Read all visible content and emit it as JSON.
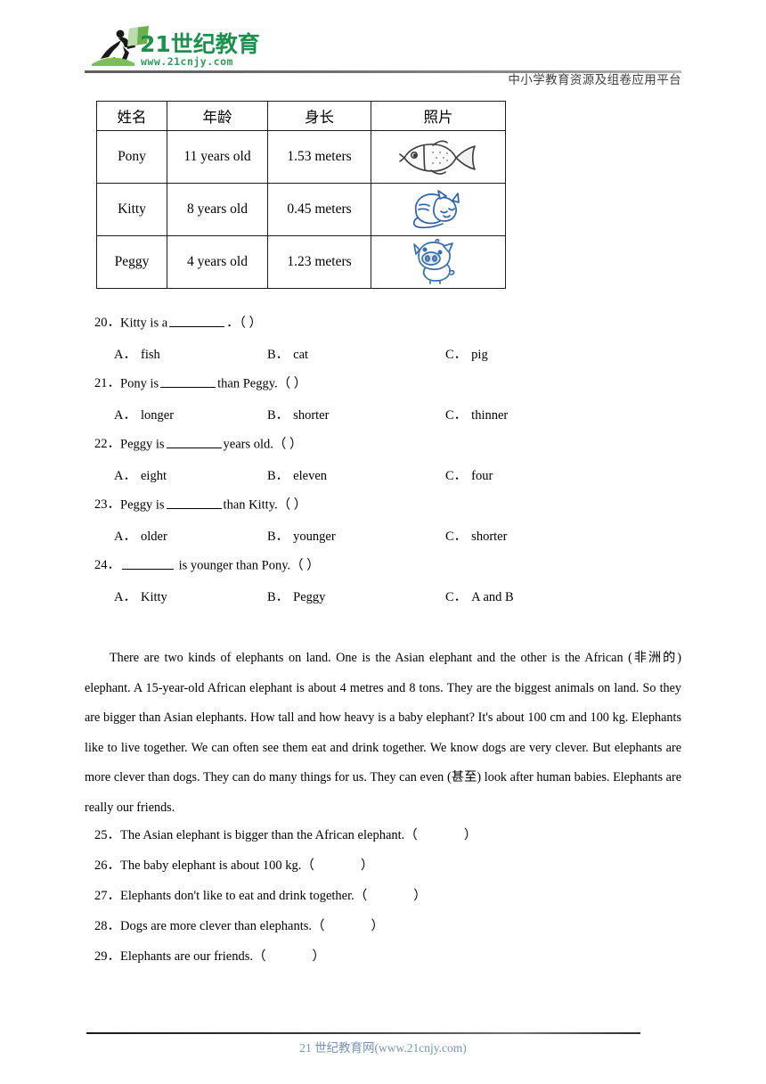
{
  "header": {
    "logo_text_cn": "21世纪教育",
    "logo_text_url": "www.21cnjy.com",
    "slogan": "中小学教育资源及组卷应用平台"
  },
  "table": {
    "headers": [
      "姓名",
      "年龄",
      "身长",
      "照片"
    ],
    "rows": [
      {
        "name": "Pony",
        "age": "11 years old",
        "length": "1.53 meters",
        "photo": "fish-illustration"
      },
      {
        "name": "Kitty",
        "age": "8 years old",
        "length": "0.45 meters",
        "photo": "cat-illustration"
      },
      {
        "name": "Peggy",
        "age": "4 years old",
        "length": "1.23 meters",
        "photo": "pig-illustration"
      }
    ]
  },
  "mcq": [
    {
      "num": "20．",
      "stem_before": "Kitty is a",
      "stem_after": "．（  ）",
      "options": [
        {
          "label": "A．",
          "text": "fish"
        },
        {
          "label": "B．",
          "text": "cat"
        },
        {
          "label": "C．",
          "text": "pig"
        }
      ]
    },
    {
      "num": "21．",
      "stem_before": "Pony is",
      "stem_after": "than Peggy.（  ）",
      "options": [
        {
          "label": "A．",
          "text": "longer"
        },
        {
          "label": "B．",
          "text": "shorter"
        },
        {
          "label": "C．",
          "text": "thinner"
        }
      ]
    },
    {
      "num": "22．",
      "stem_before": "Peggy is",
      "stem_after": "years old.（  ）",
      "options": [
        {
          "label": "A．",
          "text": "eight"
        },
        {
          "label": "B．",
          "text": "eleven"
        },
        {
          "label": "C．",
          "text": "four"
        }
      ]
    },
    {
      "num": "23．",
      "stem_before": "Peggy is",
      "stem_after": "than Kitty.（  ）",
      "options": [
        {
          "label": "A．",
          "text": "older"
        },
        {
          "label": "B．",
          "text": "younger"
        },
        {
          "label": "C．",
          "text": "shorter"
        }
      ]
    },
    {
      "num": "24．",
      "stem_before": "",
      "stem_after": "is younger than Pony.（  ）",
      "options": [
        {
          "label": "A．",
          "text": "Kitty"
        },
        {
          "label": "B．",
          "text": "Peggy"
        },
        {
          "label": "C．",
          "text": "A and B"
        }
      ]
    }
  ],
  "passage": {
    "text": "There are two kinds of elephants on land. One is the Asian elephant and the other is the African (非洲的) elephant. A 15-year-old African elephant is about 4 metres and 8 tons. They are the biggest animals on land. So they are bigger than Asian elephants. How tall and how heavy is a baby elephant? It's about 100 cm and 100 kg. Elephants like to live together. We can often see them eat and drink together. We know dogs are very clever. But elephants are more clever than dogs. They can do many things for us. They can even (甚至) look after human babies. Elephants are really our friends."
  },
  "tf_questions": [
    {
      "num": "25．",
      "text": "The Asian elephant is bigger than the African elephant.（",
      "close": "）"
    },
    {
      "num": "26．",
      "text": "The baby elephant is about 100 kg.（",
      "close": "）"
    },
    {
      "num": "27．",
      "text": "Elephants don't like to eat and drink together.（",
      "close": "）"
    },
    {
      "num": "28．",
      "text": "Dogs are more clever than elephants.（",
      "close": "）"
    },
    {
      "num": "29．",
      "text": "Elephants are our friends.（",
      "close": "）"
    }
  ],
  "footer": {
    "text": "21 世纪教育网(www.21cnjy.com)"
  }
}
